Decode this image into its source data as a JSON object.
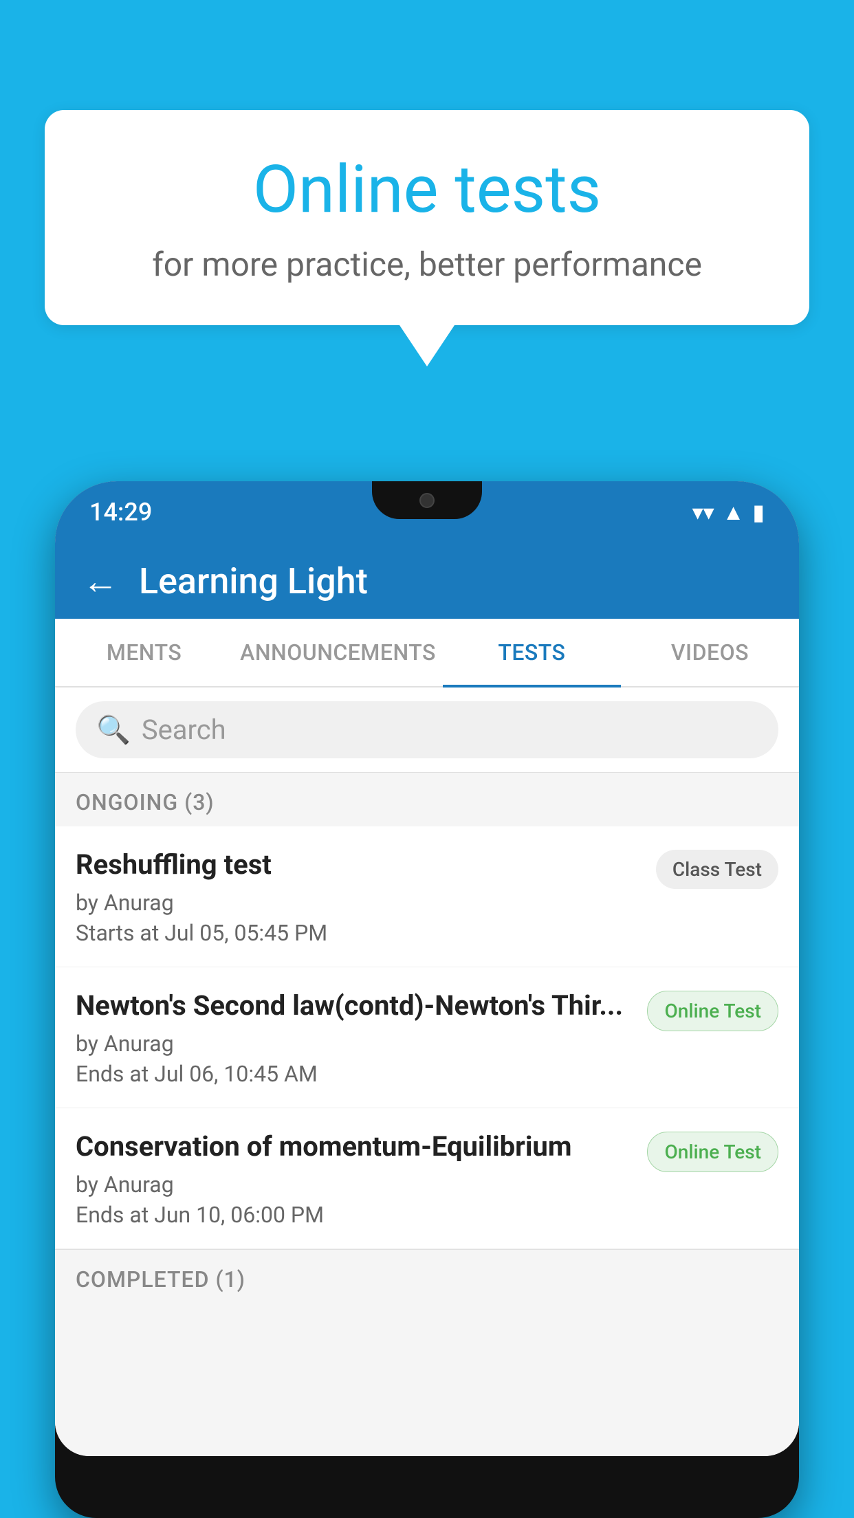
{
  "background_color": "#1ab3e8",
  "speech_bubble": {
    "title": "Online tests",
    "subtitle": "for more practice, better performance"
  },
  "phone": {
    "status_bar": {
      "time": "14:29",
      "wifi": "▾",
      "signal": "▲",
      "battery": "▪"
    },
    "app_header": {
      "back_label": "←",
      "title": "Learning Light"
    },
    "tabs": [
      {
        "label": "MENTS",
        "active": false
      },
      {
        "label": "ANNOUNCEMENTS",
        "active": false
      },
      {
        "label": "TESTS",
        "active": true
      },
      {
        "label": "VIDEOS",
        "active": false
      }
    ],
    "search": {
      "placeholder": "Search"
    },
    "ongoing_section": {
      "title": "ONGOING (3)"
    },
    "tests": [
      {
        "title": "Reshuffling test",
        "author": "by Anurag",
        "date": "Starts at  Jul 05, 05:45 PM",
        "badge": "Class Test",
        "badge_type": "class"
      },
      {
        "title": "Newton's Second law(contd)-Newton's Thir...",
        "author": "by Anurag",
        "date": "Ends at  Jul 06, 10:45 AM",
        "badge": "Online Test",
        "badge_type": "online"
      },
      {
        "title": "Conservation of momentum-Equilibrium",
        "author": "by Anurag",
        "date": "Ends at  Jun 10, 06:00 PM",
        "badge": "Online Test",
        "badge_type": "online"
      }
    ],
    "completed_section": {
      "title": "COMPLETED (1)"
    }
  }
}
